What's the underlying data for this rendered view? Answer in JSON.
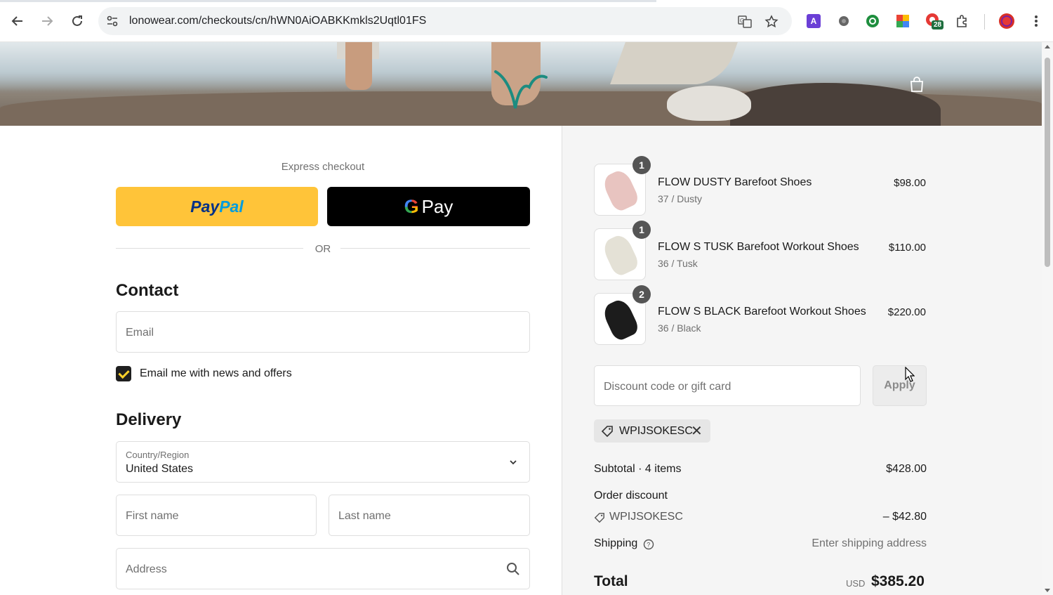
{
  "browser": {
    "url": "lonowear.com/checkouts/cn/hWN0AiOABKKmkls2Uqtl01FS",
    "extension_badge_count": "28",
    "icons": [
      "back-icon",
      "forward-icon",
      "reload-icon",
      "site-info-icon",
      "translate-icon",
      "bookmark-star-icon",
      "extension-a-icon",
      "extension-circle-icon",
      "extension-green-icon",
      "extension-sheets-icon",
      "extension-badge-icon",
      "puzzle-icon",
      "profile-avatar-icon",
      "kebab-menu-icon"
    ]
  },
  "header": {
    "icons": [
      "brand-logo-icon",
      "shopping-bag-icon"
    ]
  },
  "express": {
    "label": "Express checkout",
    "paypal_pay": "Pay",
    "paypal_pal": "Pal",
    "gpay_label": "Pay",
    "gpay_g": "G",
    "or_label": "OR"
  },
  "contact": {
    "heading": "Contact",
    "email_placeholder": "Email",
    "newsletter_label": "Email me with news and offers",
    "newsletter_checked": true
  },
  "delivery": {
    "heading": "Delivery",
    "country_label": "Country/Region",
    "country_value": "United States",
    "first_name_placeholder": "First name",
    "last_name_placeholder": "Last name",
    "address_placeholder": "Address"
  },
  "cart": {
    "items": [
      {
        "name": "FLOW DUSTY Barefoot Shoes",
        "variant": "37 / Dusty",
        "price": "$98.00",
        "qty": "1",
        "color": "#e8c4c0"
      },
      {
        "name": "FLOW S TUSK Barefoot Workout Shoes",
        "variant": "36 / Tusk",
        "price": "$110.00",
        "qty": "1",
        "color": "#e4e1d6"
      },
      {
        "name": "FLOW S BLACK Barefoot Workout Shoes",
        "variant": "36 / Black",
        "price": "$220.00",
        "qty": "2",
        "color": "#1c1c1c"
      }
    ],
    "discount_placeholder": "Discount code or gift card",
    "apply_label": "Apply",
    "applied_code": "WPIJSOKESC",
    "subtotal_label": "Subtotal · 4 items",
    "subtotal_value": "$428.00",
    "order_discount_label": "Order discount",
    "discount_code": "WPIJSOKESC",
    "discount_value": "– $42.80",
    "shipping_label": "Shipping",
    "shipping_value": "Enter shipping address",
    "total_label": "Total",
    "total_currency": "USD",
    "total_value": "$385.20"
  },
  "colors": {
    "paypal": "#ffc439",
    "gpay": "#000000",
    "summary_bg": "#f5f5f5",
    "checkbox_check": "#ffd12b"
  }
}
